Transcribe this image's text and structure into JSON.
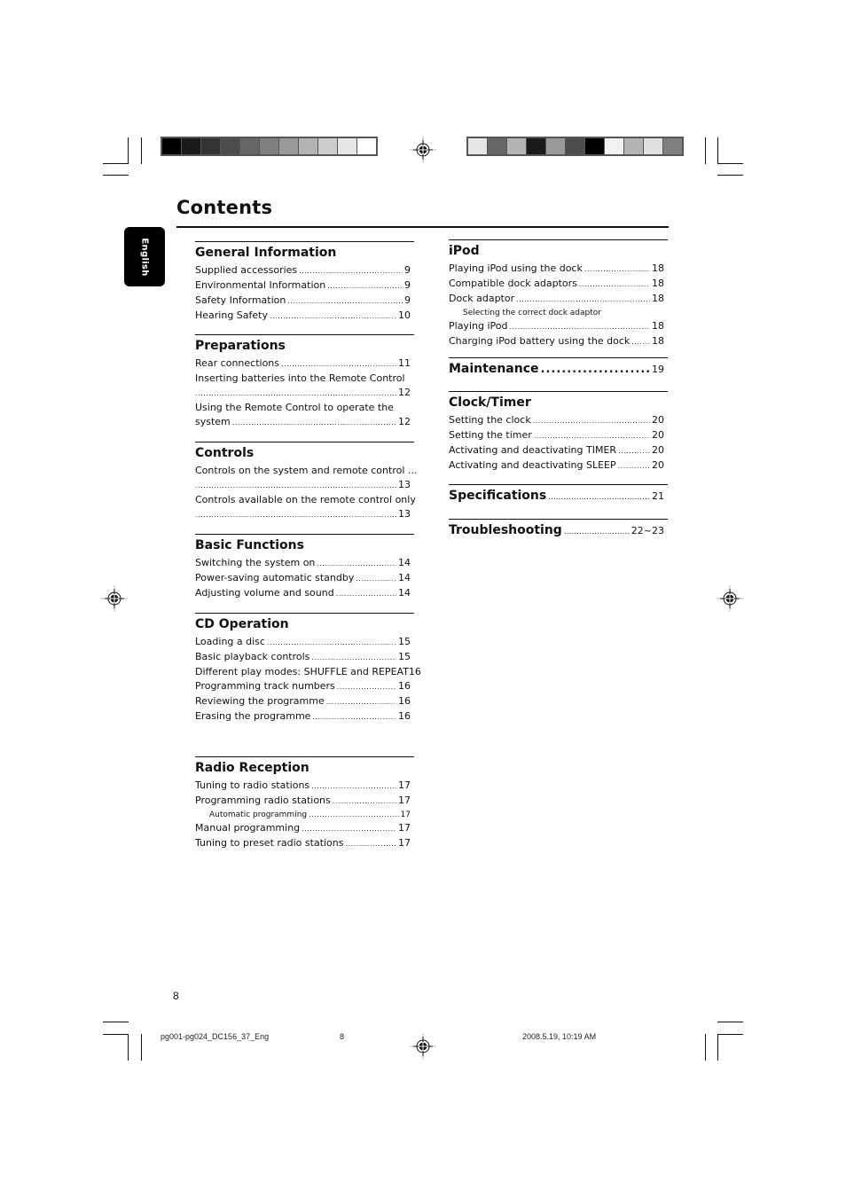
{
  "page": {
    "title": "Contents",
    "language_tab": "English",
    "page_number": "8"
  },
  "colors": {
    "left_bar": [
      "#000000",
      "#1a1a1a",
      "#333333",
      "#4d4d4d",
      "#666666",
      "#808080",
      "#999999",
      "#b3b3b3",
      "#cccccc",
      "#e6e6e6",
      "#ffffff"
    ],
    "right_bar": [
      "#e6e6e6",
      "#666666",
      "#b3b3b3",
      "#1a1a1a",
      "#999999",
      "#4d4d4d",
      "#000000",
      "#f2f2f2",
      "#b3b3b3",
      "#e0e0e0",
      "#808080"
    ]
  },
  "left_column": [
    {
      "heading": "General Information",
      "entries": [
        {
          "label": "Supplied accessories",
          "page": "9"
        },
        {
          "label": "Environmental Information",
          "page": "9"
        },
        {
          "label": "Safety Information",
          "page": "9"
        },
        {
          "label": "Hearing Safety",
          "page": "10"
        }
      ]
    },
    {
      "heading": "Preparations",
      "entries": [
        {
          "label": "Rear connections",
          "page": "11"
        },
        {
          "label": "Inserting batteries into the Remote Control",
          "page": "12"
        },
        {
          "label_line1": "Using the Remote Control to operate the",
          "label_line2": "system",
          "page": "12"
        }
      ]
    },
    {
      "heading": "Controls",
      "entries": [
        {
          "label": "Controls on the system and remote control ...",
          "page": "13"
        },
        {
          "label": "Controls available on the remote control only",
          "page": "13"
        }
      ]
    },
    {
      "heading": "Basic Functions",
      "entries": [
        {
          "label": "Switching the system on",
          "page": "14"
        },
        {
          "label": "Power-saving automatic standby",
          "page": "14"
        },
        {
          "label": "Adjusting volume and sound",
          "page": "14"
        }
      ]
    },
    {
      "heading": "CD Operation",
      "entries": [
        {
          "label": "Loading a disc",
          "page": "15"
        },
        {
          "label": "Basic playback controls",
          "page": "15"
        },
        {
          "label": "Different play modes: SHUFFLE and REPEAT",
          "page": "16"
        },
        {
          "label": "Programming track numbers",
          "page": "16"
        },
        {
          "label": "Reviewing the programme",
          "page": "16"
        },
        {
          "label": "Erasing the programme",
          "page": "16"
        }
      ]
    },
    {
      "heading": "Radio Reception",
      "entries": [
        {
          "label": "Tuning to radio stations",
          "page": "17"
        },
        {
          "label": "Programming radio stations",
          "page": "17"
        },
        {
          "label": "Automatic programming",
          "page": "17"
        },
        {
          "label": "Manual programming",
          "page": "17"
        },
        {
          "label": "Tuning to preset radio stations",
          "page": "17"
        }
      ]
    }
  ],
  "right_column": [
    {
      "heading": "iPod",
      "entries": [
        {
          "label": "Playing iPod using the dock",
          "page": "18"
        },
        {
          "label": "Compatible dock adaptors",
          "page": "18"
        },
        {
          "label": "Dock adaptor",
          "page": "18"
        },
        {
          "label": "Selecting the correct dock adaptor"
        },
        {
          "label": "Playing iPod",
          "page": "18"
        },
        {
          "label": "Charging iPod battery using the dock",
          "page": "18"
        }
      ]
    },
    {
      "heading": "Maintenance",
      "page": "19"
    },
    {
      "heading": "Clock/Timer",
      "entries": [
        {
          "label": "Setting the clock",
          "page": "20"
        },
        {
          "label": "Setting the timer",
          "page": "20"
        },
        {
          "label": "Activating and deactivating TIMER",
          "page": "20"
        },
        {
          "label": "Activating and deactivating SLEEP",
          "page": "20"
        }
      ]
    },
    {
      "heading": "Specifications",
      "page": "21"
    },
    {
      "heading": "Troubleshooting",
      "page": "22~23"
    }
  ],
  "footer": {
    "file_name": "pg001-pg024_DC156_37_Eng",
    "sheet_number": "8",
    "timestamp": "2008.5.19, 10:19 AM"
  }
}
